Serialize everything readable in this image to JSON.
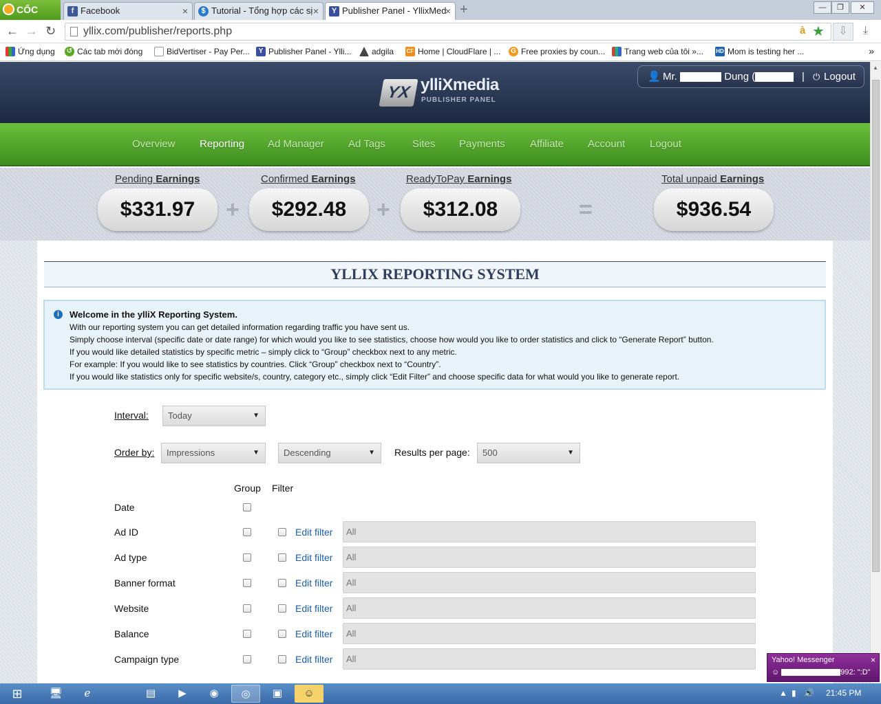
{
  "browser": {
    "brand": "CỐC CỐC",
    "tabs": [
      {
        "title": "Facebook",
        "favicon": "f"
      },
      {
        "title": "Tutorial - Tổng hợp các sị",
        "favicon": "$"
      },
      {
        "title": "Publisher Panel - YllixMed",
        "favicon": "Y"
      }
    ],
    "url": "yllix.com/publisher/reports.php",
    "bookmarks": [
      "Ứng dụng",
      "Các tab mới đóng",
      "BidVertiser - Pay Per...",
      "Publisher Panel - Ylli...",
      "adgila",
      "Home | CloudFlare | ...",
      "Free proxies by coun...",
      "Trang web của tôi »...",
      "Mom is testing her ..."
    ],
    "bookmarks_more": "»"
  },
  "header": {
    "logo_mark": "YX",
    "logo_text": "ylliXmedia",
    "logo_sub": "PUBLISHER PANEL",
    "user_prefix": "Mr.",
    "user_name": "Dung (",
    "separator": "|",
    "logout": "Logout"
  },
  "nav": {
    "items": [
      "Overview",
      "Reporting",
      "Ad Manager",
      "Ad Tags",
      "Sites",
      "Payments",
      "Affiliate",
      "Account",
      "Logout"
    ],
    "active": "Reporting"
  },
  "earnings": {
    "pending": {
      "label_prefix": "Pending",
      "label_bold": "Earnings",
      "amount": "$331.97"
    },
    "confirmed": {
      "label_prefix": "Confirmed",
      "label_bold": "Earnings",
      "amount": "$292.48"
    },
    "ready": {
      "label_prefix": "ReadyToPay",
      "label_bold": "Earnings",
      "amount": "$312.08"
    },
    "total": {
      "label_prefix": "Total unpaid",
      "label_bold": "Earnings",
      "amount": "$936.54"
    },
    "op_plus": "+",
    "op_equals": "="
  },
  "report": {
    "title": "YLLIX REPORTING SYSTEM",
    "info_title": "Welcome in the ylliX Reporting System.",
    "info_lines": [
      "With our reporting system you can get detailed information regarding traffic you have sent us.",
      "Simply choose interval (specific date or date range) for which would you like to see statistics, choose how would you like to order statistics and click to “Generate Report” button.",
      "If you would like detailed statistics by specific metric – simply click to “Group” checkbox next to any metric.",
      "For example: If you would like to see statistics by countries. Click “Group” checkbox next to “Country”.",
      "If you would like statistics only for specific website/s, country, category etc., simply click “Edit Filter” and choose specific data for what would you like to generate report."
    ],
    "interval_label": "Interval:",
    "interval_value": "Today",
    "orderby_label": "Order by:",
    "orderby_value": "Impressions",
    "direction_value": "Descending",
    "results_label": "Results per page:",
    "results_value": "500",
    "col_group": "Group",
    "col_filter": "Filter",
    "edit_filter": "Edit filter",
    "rows": [
      {
        "label": "Date",
        "filter": null
      },
      {
        "label": "Ad ID",
        "filter": "All"
      },
      {
        "label": "Ad type",
        "filter": "All"
      },
      {
        "label": "Banner format",
        "filter": "All"
      },
      {
        "label": "Website",
        "filter": "All"
      },
      {
        "label": "Balance",
        "filter": "All"
      },
      {
        "label": "Campaign type",
        "filter": "All"
      }
    ]
  },
  "popup": {
    "title": "Yahoo! Messenger",
    "message": "992: \":D\""
  },
  "taskbar": {
    "clock": "21:45 PM"
  }
}
